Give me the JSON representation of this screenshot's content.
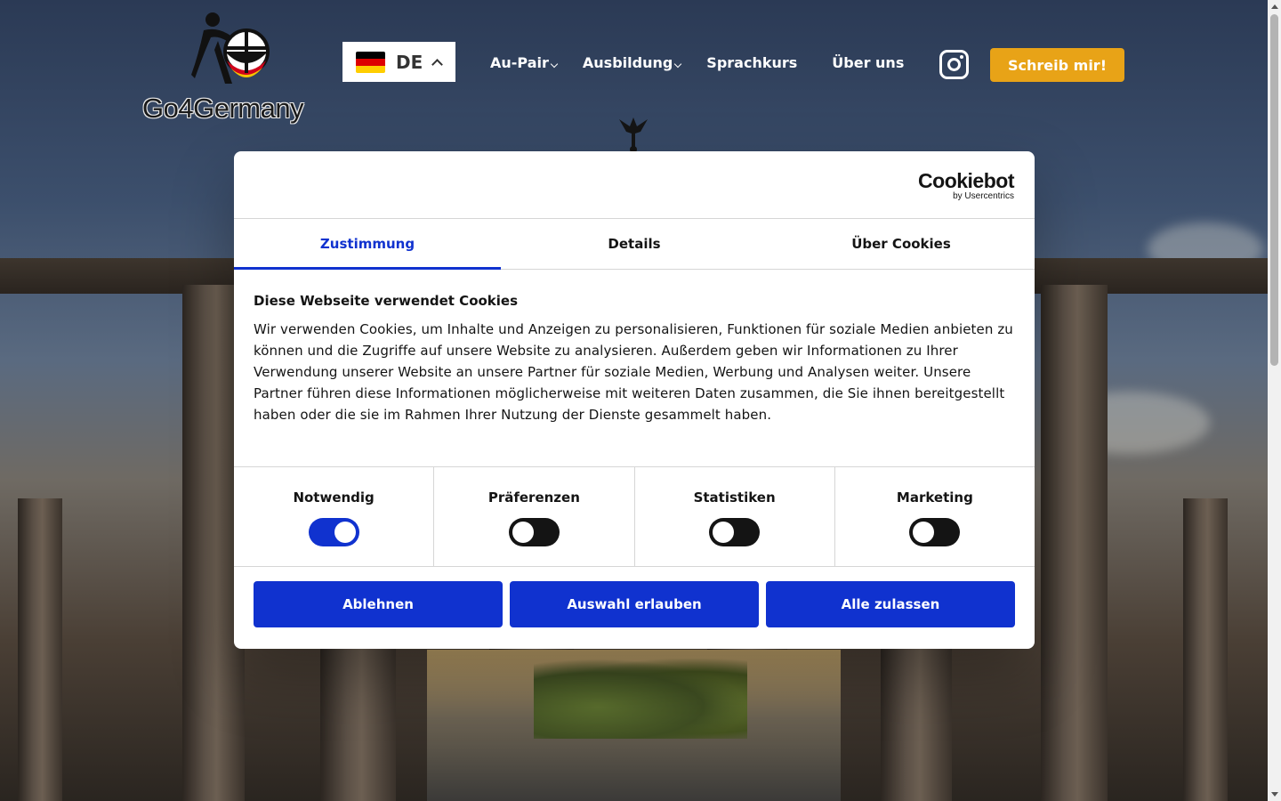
{
  "colors": {
    "accent_blue": "#1032cf",
    "cta_orange": "#e8a317",
    "toggle_off": "#141414"
  },
  "header": {
    "logo_text": "Go4Germany",
    "language": {
      "code": "DE",
      "flag_icon": "germany-flag-icon",
      "caret_icon": "chevron-up-icon"
    },
    "nav": [
      {
        "label": "Au-Pair",
        "has_dropdown": true
      },
      {
        "label": "Ausbildung",
        "has_dropdown": true
      },
      {
        "label": "Sprachkurs",
        "has_dropdown": false
      },
      {
        "label": "Über uns",
        "has_dropdown": false
      }
    ],
    "social_icon": "instagram-icon",
    "cta_label": "Schreib mir!"
  },
  "cookie_dialog": {
    "brand": {
      "name": "Cookiebot",
      "byline": "by Usercentrics"
    },
    "tabs": [
      {
        "label": "Zustimmung",
        "active": true
      },
      {
        "label": "Details",
        "active": false
      },
      {
        "label": "Über Cookies",
        "active": false
      }
    ],
    "title": "Diese Webseite verwendet Cookies",
    "text": "Wir verwenden Cookies, um Inhalte und Anzeigen zu personalisieren, Funktionen für soziale Medien anbieten zu können und die Zugriffe auf unsere Website zu analysieren. Außerdem geben wir Informationen zu Ihrer Verwendung unserer Website an unsere Partner für soziale Medien, Werbung und Analysen weiter. Unsere Partner führen diese Informationen möglicherweise mit weiteren Daten zusammen, die Sie ihnen bereitgestellt haben oder die sie im Rahmen Ihrer Nutzung der Dienste gesammelt haben.",
    "categories": [
      {
        "label": "Notwendig",
        "enabled": true
      },
      {
        "label": "Präferenzen",
        "enabled": false
      },
      {
        "label": "Statistiken",
        "enabled": false
      },
      {
        "label": "Marketing",
        "enabled": false
      }
    ],
    "buttons": {
      "deny": "Ablehnen",
      "allow_selection": "Auswahl erlauben",
      "allow_all": "Alle zulassen"
    }
  }
}
